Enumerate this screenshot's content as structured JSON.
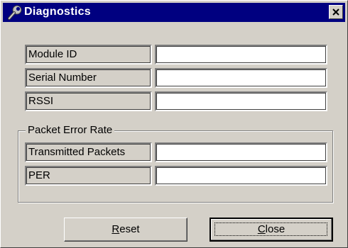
{
  "window": {
    "title": "Diagnostics",
    "title_icon": "wrench-icon",
    "close_icon": "close-icon"
  },
  "fields": [
    {
      "label": "Module ID",
      "value": ""
    },
    {
      "label": "Serial Number",
      "value": ""
    },
    {
      "label": "RSSI",
      "value": ""
    }
  ],
  "packet_group": {
    "legend": "Packet Error Rate",
    "fields": [
      {
        "label": "Transmitted Packets",
        "value": ""
      },
      {
        "label": "PER",
        "value": ""
      }
    ]
  },
  "buttons": {
    "reset_access_key": "R",
    "reset_rest": "eset",
    "close_access_key": "C",
    "close_rest": "lose"
  }
}
